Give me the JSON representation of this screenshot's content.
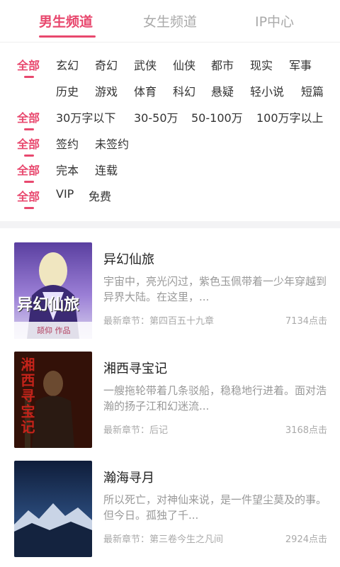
{
  "tabs": [
    {
      "label": "男生频道",
      "active": true
    },
    {
      "label": "女生频道",
      "active": false
    },
    {
      "label": "IP中心",
      "active": false
    }
  ],
  "accent_color": "#e8486e",
  "filters": {
    "all_label": "全部",
    "genre_row1": [
      "玄幻",
      "奇幻",
      "武侠",
      "仙侠",
      "都市",
      "现实",
      "军事"
    ],
    "genre_row2": [
      "历史",
      "游戏",
      "体育",
      "科幻",
      "悬疑",
      "轻小说",
      "短篇"
    ],
    "word_count": [
      "30万字以下",
      "30-50万",
      "50-100万",
      "100万字以上"
    ],
    "sign_status": [
      "签约",
      "未签约"
    ],
    "finish_status": [
      "完本",
      "连载"
    ],
    "price": [
      "VIP",
      "免费"
    ]
  },
  "books": [
    {
      "title": "异幻仙旅",
      "desc": "宇宙中，亮光闪过，紫色玉佩带着一少年穿越到异界大陆。在这里，...",
      "latest": "最新章节：第四百五十九章",
      "clicks": "7134点击",
      "cover_title": "异幻仙旅",
      "cover_author": "颉仰 作品"
    },
    {
      "title": "湘西寻宝记",
      "desc": "一艘拖轮带着几条驳船，稳稳地行进着。面对浩瀚的扬子江和幻迷流...",
      "latest": "最新章节：后记",
      "clicks": "3168点击",
      "cover_title": "湘西寻宝记"
    },
    {
      "title": "瀚海寻月",
      "desc": "所以死亡，对神仙来说，是一件望尘莫及的事。但今日。孤独了千...",
      "latest": "最新章节：第三卷今生之凡间",
      "clicks": "2924点击"
    }
  ]
}
